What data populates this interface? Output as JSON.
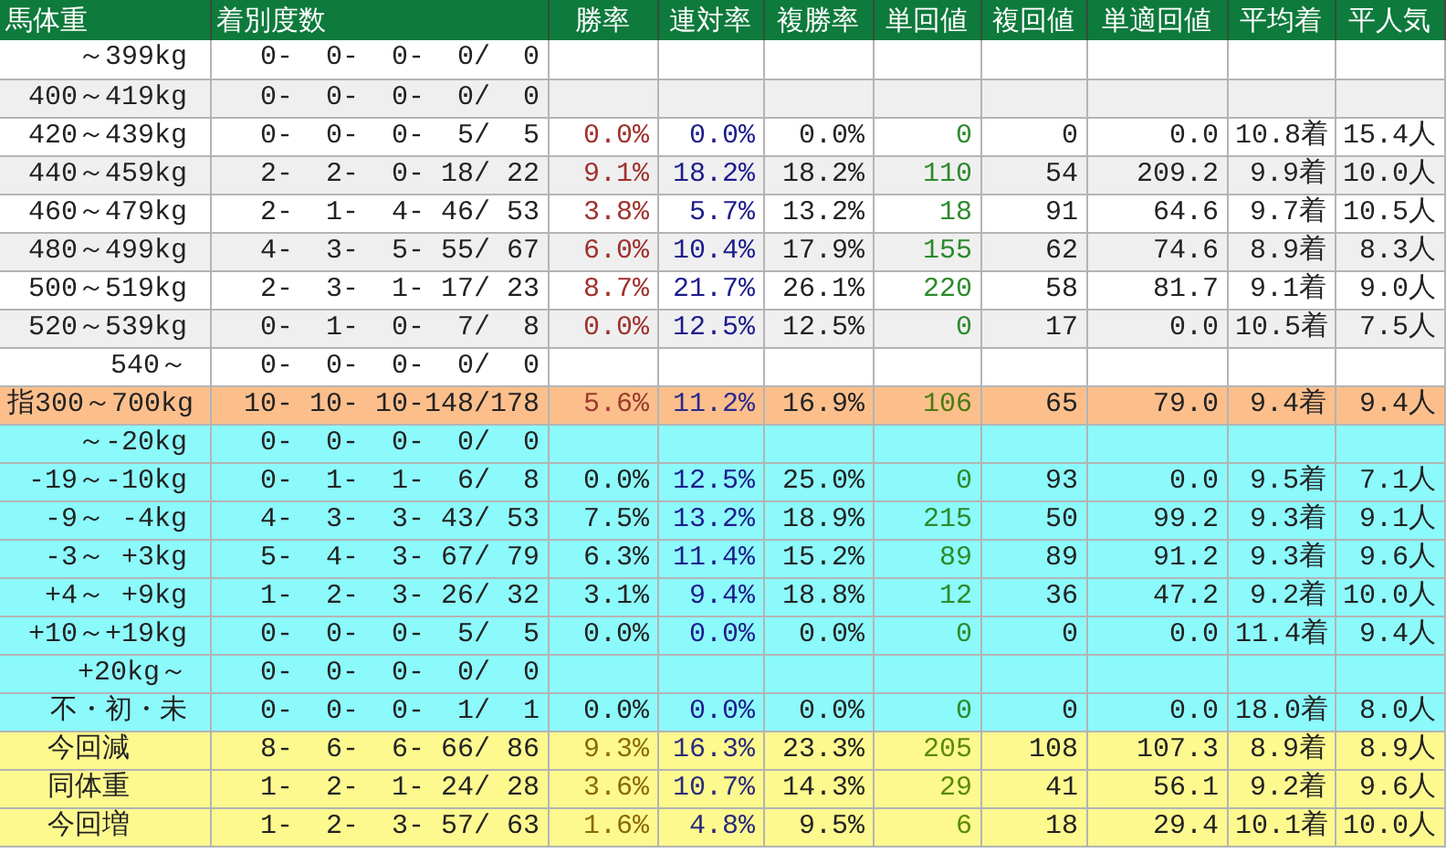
{
  "table": {
    "columns": [
      "馬体重",
      "着別度数",
      "勝率",
      "連対率",
      "複勝率",
      "単回値",
      "複回値",
      "単適回値",
      "平均着",
      "平人気"
    ],
    "rows": [
      {
        "kind": "plain",
        "label": "～399kg",
        "record": "0-  0-  0-  0/  0"
      },
      {
        "kind": "shaded",
        "label": "400～419kg",
        "record": "0-  0-  0-  0/  0"
      },
      {
        "kind": "plain",
        "label": "420～439kg",
        "record": "0-  0-  0-  5/  5",
        "stats": [
          "0.0%",
          "0.0%",
          "0.0%",
          "0",
          "0",
          "0.0",
          "10.8着",
          "15.4人"
        ]
      },
      {
        "kind": "shaded",
        "label": "440～459kg",
        "record": "2-  2-  0- 18/ 22",
        "stats": [
          "9.1%",
          "18.2%",
          "18.2%",
          "110",
          "54",
          "209.2",
          "9.9着",
          "10.0人"
        ]
      },
      {
        "kind": "plain",
        "label": "460～479kg",
        "record": "2-  1-  4- 46/ 53",
        "stats": [
          "3.8%",
          "5.7%",
          "13.2%",
          "18",
          "91",
          "64.6",
          "9.7着",
          "10.5人"
        ]
      },
      {
        "kind": "shaded",
        "label": "480～499kg",
        "record": "4-  3-  5- 55/ 67",
        "stats": [
          "6.0%",
          "10.4%",
          "17.9%",
          "155",
          "62",
          "74.6",
          "8.9着",
          "8.3人"
        ]
      },
      {
        "kind": "plain",
        "label": "500～519kg",
        "record": "2-  3-  1- 17/ 23",
        "stats": [
          "8.7%",
          "21.7%",
          "26.1%",
          "220",
          "58",
          "81.7",
          "9.1着",
          "9.0人"
        ]
      },
      {
        "kind": "shaded",
        "label": "520～539kg",
        "record": "0-  1-  0-  7/  8",
        "stats": [
          "0.0%",
          "12.5%",
          "12.5%",
          "0",
          "17",
          "0.0",
          "10.5着",
          "7.5人"
        ]
      },
      {
        "kind": "plain",
        "label": "540～",
        "record": "0-  0-  0-  0/  0"
      },
      {
        "kind": "total",
        "label": "指300～700kg",
        "record": "10- 10- 10-148/178",
        "stats": [
          "5.6%",
          "11.2%",
          "16.9%",
          "106",
          "65",
          "79.0",
          "9.4着",
          "9.4人"
        ]
      },
      {
        "kind": "change",
        "label": "～-20kg",
        "record": "0-  0-  0-  0/  0"
      },
      {
        "kind": "change",
        "label": "-19～-10kg",
        "record": "0-  1-  1-  6/  8",
        "stats": [
          "0.0%",
          "12.5%",
          "25.0%",
          "0",
          "93",
          "0.0",
          "9.5着",
          "7.1人"
        ]
      },
      {
        "kind": "change",
        "label": "-9～ -4kg",
        "record": "4-  3-  3- 43/ 53",
        "stats": [
          "7.5%",
          "13.2%",
          "18.9%",
          "215",
          "50",
          "99.2",
          "9.3着",
          "9.1人"
        ]
      },
      {
        "kind": "change",
        "label": "-3～ +3kg",
        "record": "5-  4-  3- 67/ 79",
        "stats": [
          "6.3%",
          "11.4%",
          "15.2%",
          "89",
          "89",
          "91.2",
          "9.3着",
          "9.6人"
        ]
      },
      {
        "kind": "change",
        "label": "+4～ +9kg",
        "record": "1-  2-  3- 26/ 32",
        "stats": [
          "3.1%",
          "9.4%",
          "18.8%",
          "12",
          "36",
          "47.2",
          "9.2着",
          "10.0人"
        ]
      },
      {
        "kind": "change",
        "label": "+10～+19kg",
        "record": "0-  0-  0-  5/  5",
        "stats": [
          "0.0%",
          "0.0%",
          "0.0%",
          "0",
          "0",
          "0.0",
          "11.4着",
          "9.4人"
        ]
      },
      {
        "kind": "change",
        "label": "+20kg～",
        "record": "0-  0-  0-  0/  0"
      },
      {
        "kind": "change",
        "label": "不・初・未",
        "record": "0-  0-  0-  1/  1",
        "stats": [
          "0.0%",
          "0.0%",
          "0.0%",
          "0",
          "0",
          "0.0",
          "18.0着",
          "8.0人"
        ]
      },
      {
        "kind": "summary",
        "label": "今回減",
        "record": "8-  6-  6- 66/ 86",
        "stats": [
          "9.3%",
          "16.3%",
          "23.3%",
          "205",
          "108",
          "107.3",
          "8.9着",
          "8.9人"
        ]
      },
      {
        "kind": "summary",
        "label": "同体重",
        "record": "1-  2-  1- 24/ 28",
        "stats": [
          "3.6%",
          "10.7%",
          "14.3%",
          "29",
          "41",
          "56.1",
          "9.2着",
          "9.6人"
        ]
      },
      {
        "kind": "summary",
        "label": "今回増",
        "record": "1-  2-  3- 57/ 63",
        "stats": [
          "1.6%",
          "4.8%",
          "9.5%",
          "6",
          "18",
          "29.4",
          "10.1着",
          "10.0人"
        ]
      }
    ]
  }
}
